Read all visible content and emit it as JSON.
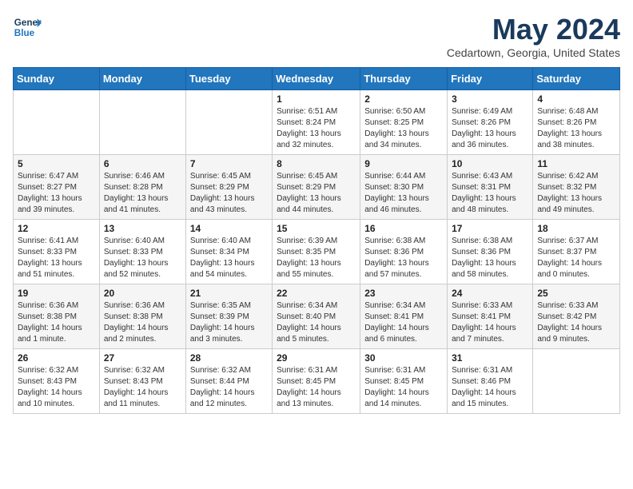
{
  "header": {
    "logo_line1": "General",
    "logo_line2": "Blue",
    "month_title": "May 2024",
    "subtitle": "Cedartown, Georgia, United States"
  },
  "weekdays": [
    "Sunday",
    "Monday",
    "Tuesday",
    "Wednesday",
    "Thursday",
    "Friday",
    "Saturday"
  ],
  "weeks": [
    [
      {
        "day": "",
        "sunrise": "",
        "sunset": "",
        "daylight": ""
      },
      {
        "day": "",
        "sunrise": "",
        "sunset": "",
        "daylight": ""
      },
      {
        "day": "",
        "sunrise": "",
        "sunset": "",
        "daylight": ""
      },
      {
        "day": "1",
        "sunrise": "Sunrise: 6:51 AM",
        "sunset": "Sunset: 8:24 PM",
        "daylight": "Daylight: 13 hours and 32 minutes."
      },
      {
        "day": "2",
        "sunrise": "Sunrise: 6:50 AM",
        "sunset": "Sunset: 8:25 PM",
        "daylight": "Daylight: 13 hours and 34 minutes."
      },
      {
        "day": "3",
        "sunrise": "Sunrise: 6:49 AM",
        "sunset": "Sunset: 8:26 PM",
        "daylight": "Daylight: 13 hours and 36 minutes."
      },
      {
        "day": "4",
        "sunrise": "Sunrise: 6:48 AM",
        "sunset": "Sunset: 8:26 PM",
        "daylight": "Daylight: 13 hours and 38 minutes."
      }
    ],
    [
      {
        "day": "5",
        "sunrise": "Sunrise: 6:47 AM",
        "sunset": "Sunset: 8:27 PM",
        "daylight": "Daylight: 13 hours and 39 minutes."
      },
      {
        "day": "6",
        "sunrise": "Sunrise: 6:46 AM",
        "sunset": "Sunset: 8:28 PM",
        "daylight": "Daylight: 13 hours and 41 minutes."
      },
      {
        "day": "7",
        "sunrise": "Sunrise: 6:45 AM",
        "sunset": "Sunset: 8:29 PM",
        "daylight": "Daylight: 13 hours and 43 minutes."
      },
      {
        "day": "8",
        "sunrise": "Sunrise: 6:45 AM",
        "sunset": "Sunset: 8:29 PM",
        "daylight": "Daylight: 13 hours and 44 minutes."
      },
      {
        "day": "9",
        "sunrise": "Sunrise: 6:44 AM",
        "sunset": "Sunset: 8:30 PM",
        "daylight": "Daylight: 13 hours and 46 minutes."
      },
      {
        "day": "10",
        "sunrise": "Sunrise: 6:43 AM",
        "sunset": "Sunset: 8:31 PM",
        "daylight": "Daylight: 13 hours and 48 minutes."
      },
      {
        "day": "11",
        "sunrise": "Sunrise: 6:42 AM",
        "sunset": "Sunset: 8:32 PM",
        "daylight": "Daylight: 13 hours and 49 minutes."
      }
    ],
    [
      {
        "day": "12",
        "sunrise": "Sunrise: 6:41 AM",
        "sunset": "Sunset: 8:33 PM",
        "daylight": "Daylight: 13 hours and 51 minutes."
      },
      {
        "day": "13",
        "sunrise": "Sunrise: 6:40 AM",
        "sunset": "Sunset: 8:33 PM",
        "daylight": "Daylight: 13 hours and 52 minutes."
      },
      {
        "day": "14",
        "sunrise": "Sunrise: 6:40 AM",
        "sunset": "Sunset: 8:34 PM",
        "daylight": "Daylight: 13 hours and 54 minutes."
      },
      {
        "day": "15",
        "sunrise": "Sunrise: 6:39 AM",
        "sunset": "Sunset: 8:35 PM",
        "daylight": "Daylight: 13 hours and 55 minutes."
      },
      {
        "day": "16",
        "sunrise": "Sunrise: 6:38 AM",
        "sunset": "Sunset: 8:36 PM",
        "daylight": "Daylight: 13 hours and 57 minutes."
      },
      {
        "day": "17",
        "sunrise": "Sunrise: 6:38 AM",
        "sunset": "Sunset: 8:36 PM",
        "daylight": "Daylight: 13 hours and 58 minutes."
      },
      {
        "day": "18",
        "sunrise": "Sunrise: 6:37 AM",
        "sunset": "Sunset: 8:37 PM",
        "daylight": "Daylight: 14 hours and 0 minutes."
      }
    ],
    [
      {
        "day": "19",
        "sunrise": "Sunrise: 6:36 AM",
        "sunset": "Sunset: 8:38 PM",
        "daylight": "Daylight: 14 hours and 1 minute."
      },
      {
        "day": "20",
        "sunrise": "Sunrise: 6:36 AM",
        "sunset": "Sunset: 8:38 PM",
        "daylight": "Daylight: 14 hours and 2 minutes."
      },
      {
        "day": "21",
        "sunrise": "Sunrise: 6:35 AM",
        "sunset": "Sunset: 8:39 PM",
        "daylight": "Daylight: 14 hours and 3 minutes."
      },
      {
        "day": "22",
        "sunrise": "Sunrise: 6:34 AM",
        "sunset": "Sunset: 8:40 PM",
        "daylight": "Daylight: 14 hours and 5 minutes."
      },
      {
        "day": "23",
        "sunrise": "Sunrise: 6:34 AM",
        "sunset": "Sunset: 8:41 PM",
        "daylight": "Daylight: 14 hours and 6 minutes."
      },
      {
        "day": "24",
        "sunrise": "Sunrise: 6:33 AM",
        "sunset": "Sunset: 8:41 PM",
        "daylight": "Daylight: 14 hours and 7 minutes."
      },
      {
        "day": "25",
        "sunrise": "Sunrise: 6:33 AM",
        "sunset": "Sunset: 8:42 PM",
        "daylight": "Daylight: 14 hours and 9 minutes."
      }
    ],
    [
      {
        "day": "26",
        "sunrise": "Sunrise: 6:32 AM",
        "sunset": "Sunset: 8:43 PM",
        "daylight": "Daylight: 14 hours and 10 minutes."
      },
      {
        "day": "27",
        "sunrise": "Sunrise: 6:32 AM",
        "sunset": "Sunset: 8:43 PM",
        "daylight": "Daylight: 14 hours and 11 minutes."
      },
      {
        "day": "28",
        "sunrise": "Sunrise: 6:32 AM",
        "sunset": "Sunset: 8:44 PM",
        "daylight": "Daylight: 14 hours and 12 minutes."
      },
      {
        "day": "29",
        "sunrise": "Sunrise: 6:31 AM",
        "sunset": "Sunset: 8:45 PM",
        "daylight": "Daylight: 14 hours and 13 minutes."
      },
      {
        "day": "30",
        "sunrise": "Sunrise: 6:31 AM",
        "sunset": "Sunset: 8:45 PM",
        "daylight": "Daylight: 14 hours and 14 minutes."
      },
      {
        "day": "31",
        "sunrise": "Sunrise: 6:31 AM",
        "sunset": "Sunset: 8:46 PM",
        "daylight": "Daylight: 14 hours and 15 minutes."
      },
      {
        "day": "",
        "sunrise": "",
        "sunset": "",
        "daylight": ""
      }
    ]
  ]
}
